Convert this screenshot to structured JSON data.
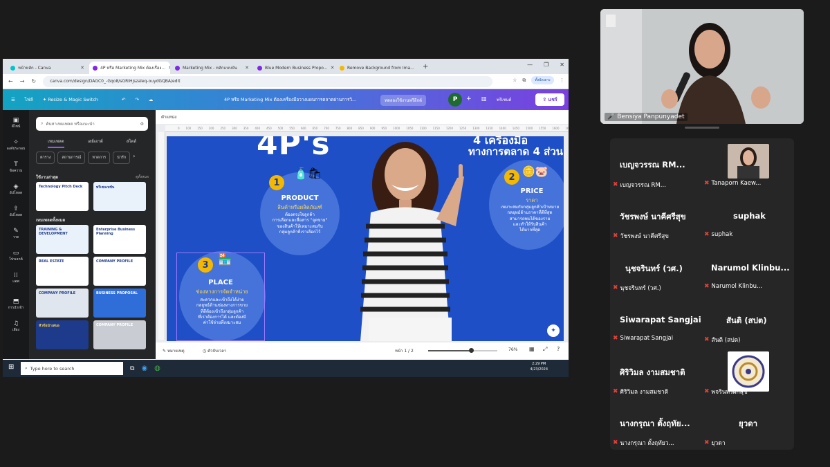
{
  "browser": {
    "tabs": [
      {
        "label": "หน้าหลัก - Canva",
        "active": false,
        "color": "#00c4cc"
      },
      {
        "label": "4P หรือ Marketing Mix ต้องเรื่อง...",
        "active": true,
        "color": "#7d2ae8"
      },
      {
        "label": "Marketing Mix - หลักแบบบัน",
        "active": false,
        "color": "#7d2ae8"
      },
      {
        "label": "Blue Modern Business Propo...",
        "active": false,
        "color": "#7d2ae8"
      },
      {
        "label": "Remove Background from Ima...",
        "active": false,
        "color": "#f5b800"
      }
    ],
    "new_tab": "+",
    "window_controls": [
      "—",
      "❐",
      "✕"
    ],
    "url": "canva.com/design/DAGC0_-Gqo8/sGRIHjszaleq-ouydGQBA/edit",
    "profile_pill": "ทั้งนักเดาะ"
  },
  "canva": {
    "home": "ไฟล์",
    "resize": "Resize & Magic Switch",
    "doc_title": "4P หรือ Marketing Mix ต้องเครื่องมือวางแผนการตลาดผ่านการวิ...",
    "trial": "ทดลองใช้งานฟรีอีกด์",
    "avatar": "P",
    "present": "พรีเซนต์",
    "share": "แชร์"
  },
  "rail": [
    "ดีไซน์",
    "องค์ประกอบ",
    "ข้อความ",
    "อัปโหลด",
    "อัปโหลด",
    "วาด",
    "โปรเจกต์",
    "แอพ",
    "การนำเข้า",
    "เสียง"
  ],
  "panel": {
    "search_placeholder": "ค้นหาเทมเพลต หรือแนะนำ",
    "tabs": [
      "เทมเพลต",
      "เลย์เอาต์",
      "สไตล์"
    ],
    "chips": [
      "ตาราง",
      "สถานการณ์",
      "หาดการ",
      "น่ารัก"
    ],
    "recent_title": "ใช้งานล่าสุด",
    "see_all": "ดูทั้งหมด",
    "all_title": "เทมเพลตทั้งหมด",
    "thumbs": [
      {
        "text": "Technology Pitch Deck",
        "bg": "#ffffff",
        "fg": "#1e3a8a"
      },
      {
        "text": "พรีเซนเทชัน",
        "bg": "#e9f1fb",
        "fg": "#1e3a8a"
      },
      {
        "text": "TRAINING & DEVELOPMENT",
        "bg": "#e9f1fb",
        "fg": "#1e3a8a"
      },
      {
        "text": "Enterprise Business Planning",
        "bg": "#ffffff",
        "fg": "#1e3a8a"
      },
      {
        "text": "REAL ESTATE",
        "bg": "#ffffff",
        "fg": "#1e3a8a"
      },
      {
        "text": "COMPANY PROFILE",
        "bg": "#ffffff",
        "fg": "#1e3a8a"
      },
      {
        "text": "COMPANY PROFILE",
        "bg": "#dfe6ee",
        "fg": "#1e3a8a"
      },
      {
        "text": "BUSINESS PROPOSAL",
        "bg": "#2f6ed8",
        "fg": "#ffffff"
      },
      {
        "text": "หัวข้อนำเสนอ",
        "bg": "#1e3a8a",
        "fg": "#ffd84a"
      },
      {
        "text": "COMPANY PROFILE",
        "bg": "#c9ccd2",
        "fg": "#ffffff"
      }
    ]
  },
  "workspace": {
    "toolbar_label": "ตำแหน่ง",
    "ruler": [
      "0",
      "100",
      "150",
      "200",
      "250",
      "300",
      "350",
      "400",
      "450",
      "500",
      "550",
      "600",
      "650",
      "700",
      "750",
      "800",
      "850",
      "900",
      "950",
      "1000",
      "1050",
      "1100",
      "1150",
      "1200",
      "1250",
      "1300",
      "1350",
      "1400",
      "1450",
      "1500",
      "1550",
      "1600",
      "1650",
      "1700",
      "1750",
      "1800",
      "1850"
    ],
    "notes": "หมายเหตุ",
    "timer": "ตัวจับเวลา",
    "page": "หน้า 1 / 2",
    "zoom": "76%",
    "zoom_level": 0.62
  },
  "slide": {
    "big_title": "4P's",
    "right_title_1": "4 เครื่องมือ",
    "right_title_2": "ทางการตลาด 4 ส่วน",
    "items": [
      {
        "num": "1",
        "title": "PRODUCT",
        "sub": "สินค้าหรือผลิตภัณฑ์",
        "desc": "ต้องตรงใจลูกค้า\nการเลือกและสื่อสาร \"จุดขาย\"\nของสินค้าให้เหมาะสมกับ\nกลุ่มลูกค้าที่เราเลือกไว้"
      },
      {
        "num": "2",
        "title": "PRICE",
        "sub": "ราคา",
        "desc": "เหมาะสมกับกลุ่มลูกค้าเป้าหมาย\nกลยุทธ์ด้านราคาที่ดีที่สุด\nสามารถพบได้ของราย\nและทำให้รับสินค้า\nได้มากที่สุด"
      },
      {
        "num": "3",
        "title": "PLACE",
        "sub": "ช่องทางการจัดจำหน่าย",
        "desc": "สะดวกและเข้าถึงได้ง่าย\nกลยุทธ์ด้านช่องทางการขาย\nที่ดีต้องเข้าถึงกลุ่มลูกค้า\nที่เราต้องการได้ และต้องมี\nค่าใช้จ่ายที่เหมาะสม"
      }
    ]
  },
  "taskbar": {
    "search": "Type here to search",
    "time": "2:29 PM",
    "date": "4/23/2024"
  },
  "meeting": {
    "speaker": "Bensiya Panpunyadet",
    "participants": [
      {
        "name": "เบญจวรรณ RM...",
        "label": "เบญจวรรณ RM..."
      },
      {
        "name": "",
        "label": "Tanaporn Kaew..."
      },
      {
        "name": "วัชรพงษ์ นาคีศรีสุข",
        "label": "วัชรพงษ์ นาคีศรีสุข"
      },
      {
        "name": "suphak",
        "label": "suphak"
      },
      {
        "name": "นุชจรินทร์ (วศ.)",
        "label": "นุชจรินทร์ (วศ.)"
      },
      {
        "name": "Narumol Klinbu...",
        "label": "Narumol Klinbu..."
      },
      {
        "name": "Siwarapat Sangjai",
        "label": "Siwarapat Sangjai"
      },
      {
        "name": "สันติ (สปต)",
        "label": "สันติ (สปต)"
      },
      {
        "name": "ศิริวิมล งามสมชาติ",
        "label": "ศิริวิมล งามสมชาติ"
      },
      {
        "name": "",
        "label": "พจรินทร์ผกสุข"
      },
      {
        "name": "นางกรุณา ตั้งฤทัย...",
        "label": "นางกรุณา ตั้งฤทัยว..."
      },
      {
        "name": "ยุวดา",
        "label": "ยุวดา"
      }
    ]
  }
}
